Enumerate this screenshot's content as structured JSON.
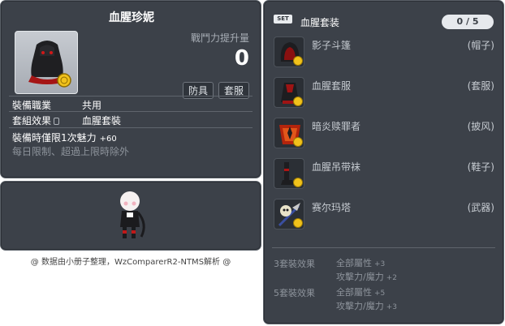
{
  "item_id": "01052643",
  "tooltip": {
    "title": "血腥珍妮",
    "power_label": "戰鬥力提升量",
    "power_value": "0",
    "tags": [
      "防具",
      "套服"
    ],
    "job_label": "裝備職業",
    "job_value": "共用",
    "set_label": "套組效果",
    "set_value": "血腥套裝",
    "limit_text": "裝備時僅限1次魅力",
    "limit_plus": "+60",
    "daily_text": "每日限制、超過上限時除外"
  },
  "credit": "@ 数据由小册子整理，WzComparerR2-NTMS解析 @",
  "set_panel": {
    "badge": "SET",
    "title": "血腥套装",
    "count": "0 / 5",
    "pieces": [
      {
        "name": "影子斗篷",
        "slot": "(帽子)",
        "icon": "hood-icon"
      },
      {
        "name": "血腥套服",
        "slot": "(套服)",
        "icon": "overall-icon"
      },
      {
        "name": "暗炎赎罪者",
        "slot": "(披风)",
        "icon": "cape-icon"
      },
      {
        "name": "血腥吊带袜",
        "slot": "(鞋子)",
        "icon": "stockings-icon"
      },
      {
        "name": "赛尔玛塔",
        "slot": "(武器)",
        "icon": "weapon-icon"
      }
    ],
    "bonuses": [
      {
        "label": "3套裝效果",
        "stat1": "全部屬性",
        "stat1_val": "+3",
        "stat2": "攻擊力/魔力",
        "stat2_val": "+2"
      },
      {
        "label": "5套裝效果",
        "stat1": "全部屬性",
        "stat1_val": "+5",
        "stat2": "攻擊力/魔力",
        "stat2_val": "+3"
      }
    ]
  },
  "colors": {
    "panel": "#3c4149",
    "text": "#ffffff",
    "muted": "#8d939b",
    "coin": "#f1c21b"
  }
}
